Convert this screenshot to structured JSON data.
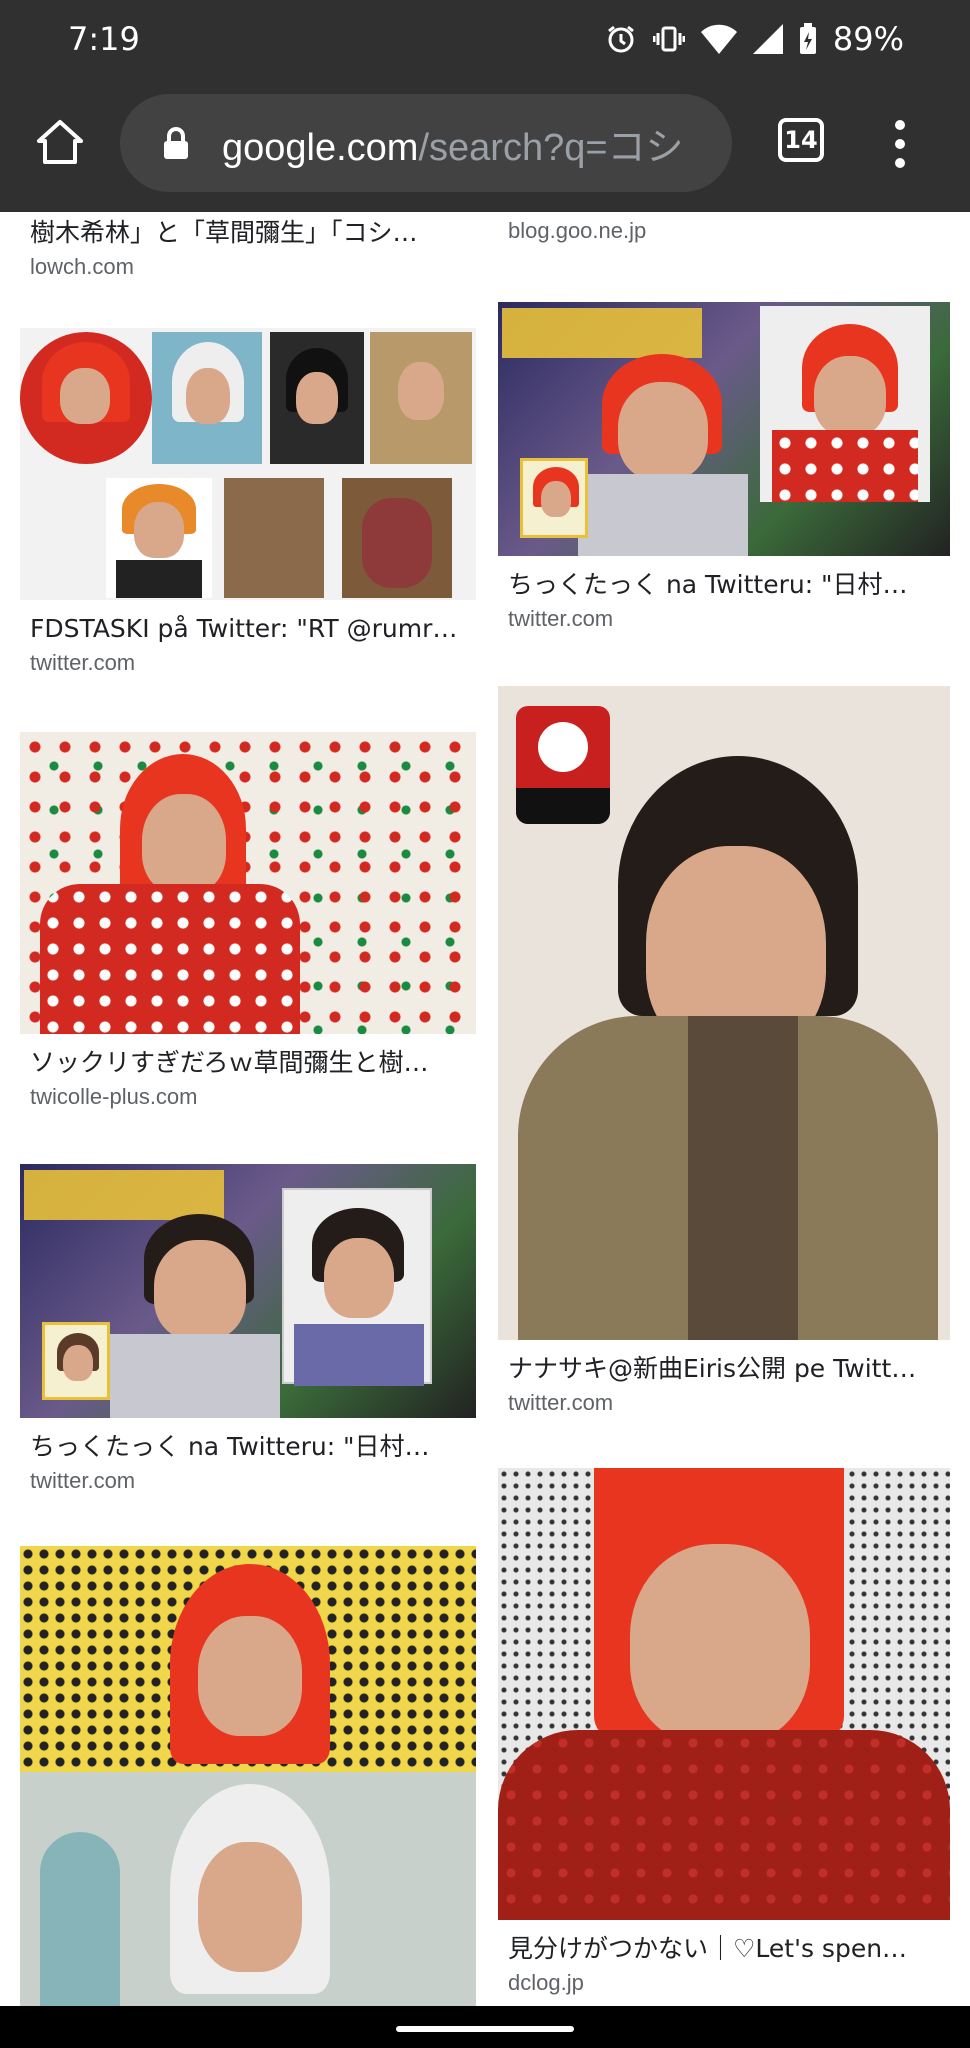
{
  "status_bar": {
    "time": "7:19",
    "battery": "89%",
    "icons": [
      "alarm-icon",
      "vibrate-icon",
      "wifi-icon",
      "signal-icon",
      "battery-charging-icon"
    ]
  },
  "toolbar": {
    "url_host": "google.com",
    "url_path": "/search?q=コシ",
    "tab_count": "14"
  },
  "results": [
    {
      "title": "樹木希林」と「草間彌生」「コシ…",
      "site": "lowch.com"
    },
    {
      "title": "",
      "site": "blog.goo.ne.jp"
    },
    {
      "title": "FDSTASKI på Twitter: \"RT @rumr…",
      "site": "twitter.com"
    },
    {
      "title": "ちっくたっく na Twitteru: \"日村…",
      "site": "twitter.com"
    },
    {
      "title": "ソックリすぎだろｗ草間彌生と樹…",
      "site": "twicolle-plus.com"
    },
    {
      "title": "ナナサキ@新曲Eiris公開 pe Twitt…",
      "site": "twitter.com"
    },
    {
      "title": "ちっくたっく na Twitteru: \"日村…",
      "site": "twitter.com"
    },
    {
      "title": "見分けがつかない｜♡Let's spen…",
      "site": "dclog.jp"
    }
  ]
}
